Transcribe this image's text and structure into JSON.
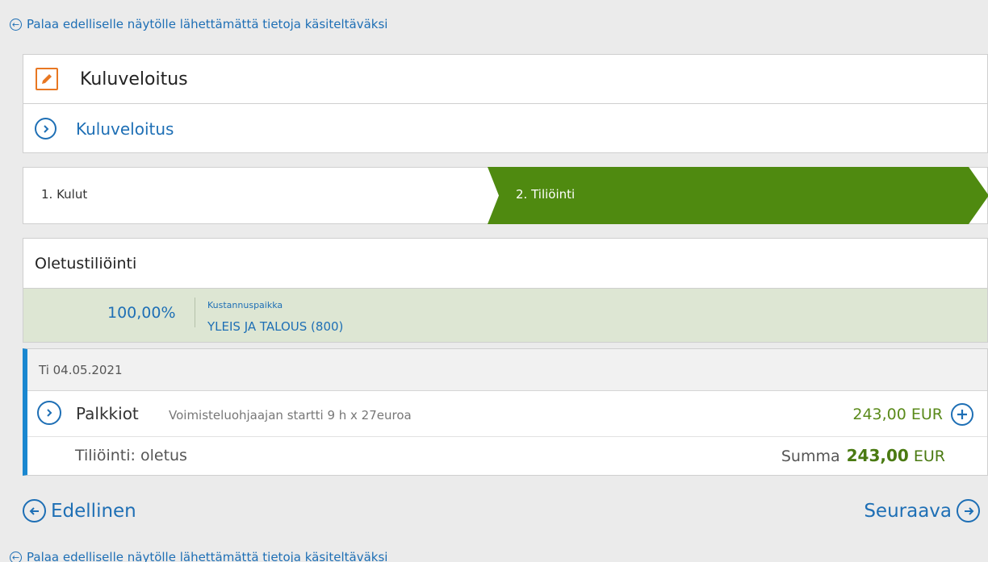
{
  "back_link": {
    "text": "Palaa edelliselle näytölle lähettämättä tietoja käsiteltäväksi",
    "icon": "arrow-left-circle-icon"
  },
  "header": {
    "title": "Kuluveloitus",
    "title_icon": "pencil-edit-icon",
    "link_label": "Kuluveloitus",
    "link_icon": "chevron-right-circle-icon"
  },
  "steps": [
    {
      "label": "1. Kulut",
      "active": false
    },
    {
      "label": "2. Tiliöinti",
      "active": true
    }
  ],
  "default_posting": {
    "title": "Oletustiliöinti",
    "percent": "100,00%",
    "cost_center_label": "Kustannuspaikka",
    "cost_center_value": "YLEIS JA TALOUS (800)"
  },
  "expense": {
    "date": "Ti 04.05.2021",
    "item": {
      "name": "Palkkiot",
      "description": "Voimisteluohjaajan startti 9 h x 27euroa",
      "amount": "243,00 EUR"
    },
    "posting_label": "Tiliöinti: oletus",
    "sum_label": "Summa",
    "sum_amount": "243,00",
    "sum_currency": "EUR"
  },
  "nav": {
    "previous": "Edellinen",
    "next": "Seuraava"
  },
  "colors": {
    "link_blue": "#1e6fb5",
    "active_step_green": "#4f8a10",
    "amount_green": "#5a8a1a",
    "band_green": "#dde6d3",
    "edit_orange": "#e87722",
    "accent_blue_bar": "#1a87d0"
  }
}
